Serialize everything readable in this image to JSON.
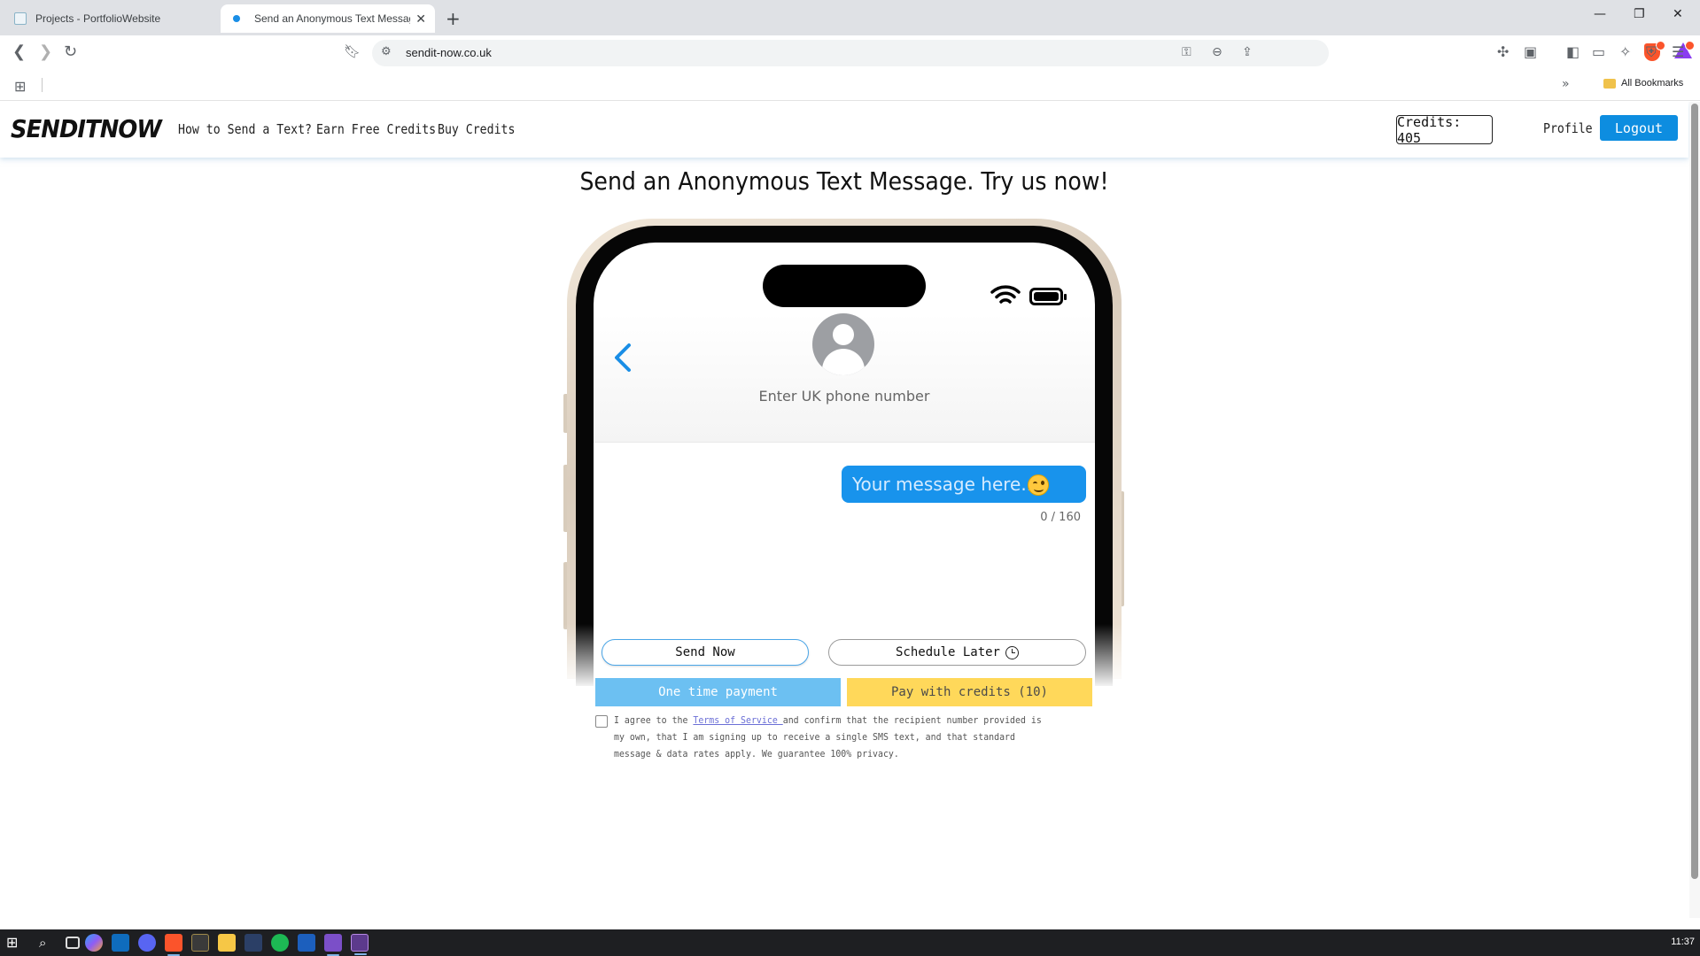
{
  "browser": {
    "tabs": [
      {
        "title": "Projects - PortfolioWebsite",
        "active": false
      },
      {
        "title": "Send an Anonymous Text Message",
        "active": true
      }
    ],
    "url": "sendit-now.co.uk",
    "bookmarks_all_label": "All Bookmarks"
  },
  "site": {
    "logo": "SENDITNOW",
    "nav": [
      "How to Send a Text?",
      "Earn Free Credits",
      "Buy Credits"
    ],
    "credits_label": "Credits: 405",
    "profile_label": "Profile",
    "logout_label": "Logout"
  },
  "main": {
    "headline": "Send an Anonymous Text Message. Try us now!",
    "phone_placeholder": "Enter UK phone number",
    "message_placeholder": "Your message here...",
    "char_counter": "0 / 160",
    "send_now_label": "Send Now",
    "schedule_label": "Schedule Later",
    "one_time_payment_label": "One time payment",
    "pay_credits_label": "Pay with credits (10)",
    "terms_prefix": "I agree to the ",
    "terms_link": "Terms of Service ",
    "terms_suffix": "and confirm that the recipient number provided is my own, that I am signing up to receive a single SMS text, and that standard message & data rates apply. We guarantee 100% privacy."
  },
  "taskbar": {
    "clock": "11:37"
  },
  "colors": {
    "accent_blue": "#0d8de0",
    "bubble_blue": "#1893ec",
    "pay_blue": "#6cc0f2",
    "pay_yellow": "#ffd85a"
  }
}
